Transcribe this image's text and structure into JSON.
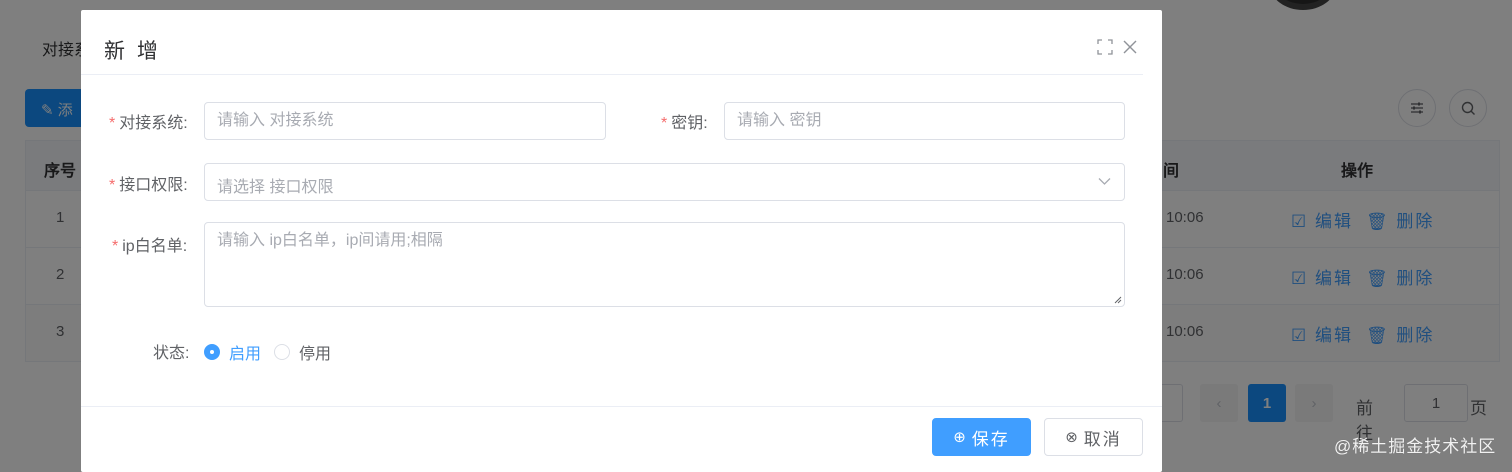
{
  "background": {
    "breadcrumb": "对接系",
    "add_button": "添",
    "table": {
      "headers": {
        "index": "序号",
        "time_suffix": "间",
        "operations": "操作"
      },
      "rows": [
        {
          "index": "1",
          "time": "10:06",
          "edit": "编辑",
          "delete": "删除"
        },
        {
          "index": "2",
          "time": "10:06",
          "edit": "编辑",
          "delete": "删除"
        },
        {
          "index": "3",
          "time": "10:06",
          "edit": "编辑",
          "delete": "删除"
        }
      ]
    },
    "pagination": {
      "current_page": "1",
      "goto_label": "前往",
      "goto_value": "1",
      "page_suffix": "页"
    },
    "watermark": "@稀土掘金技术社区"
  },
  "dialog": {
    "title": "新 增",
    "fields": {
      "system": {
        "label": "对接系统:",
        "placeholder": "请输入 对接系统",
        "value": ""
      },
      "secret": {
        "label": "密钥:",
        "placeholder": "请输入 密钥",
        "value": ""
      },
      "permission": {
        "label": "接口权限:",
        "placeholder": "请选择 接口权限"
      },
      "whitelist": {
        "label": "ip白名单:",
        "placeholder": "请输入 ip白名单，ip间请用;相隔",
        "value": ""
      },
      "status": {
        "label": "状态:",
        "options": [
          "启用",
          "停用"
        ],
        "selected": "启用"
      }
    },
    "buttons": {
      "save": "保存",
      "cancel": "取消"
    }
  },
  "colors": {
    "primary": "#409eff",
    "required": "#f56c6c",
    "overlay": "rgba(0,0,0,0.5)"
  }
}
